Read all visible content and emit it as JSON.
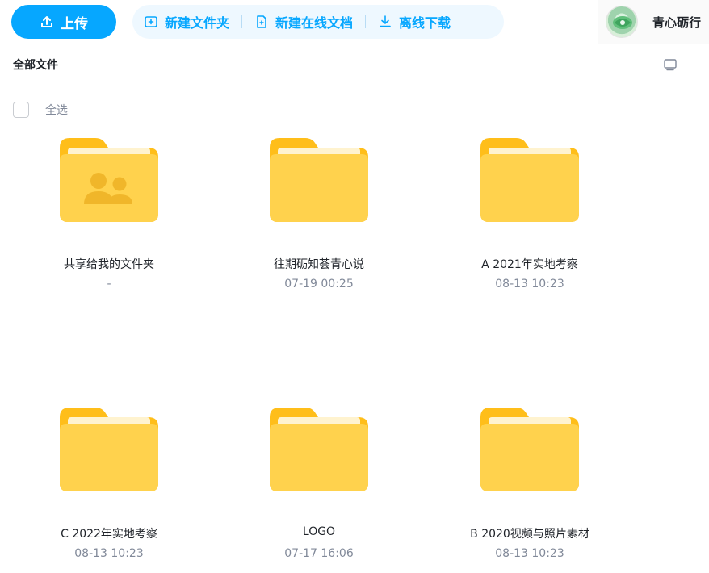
{
  "toolbar": {
    "upload_label": "上传",
    "new_folder_label": "新建文件夹",
    "new_online_doc_label": "新建在线文档",
    "offline_download_label": "离线下载"
  },
  "user": {
    "name": "青心砺行"
  },
  "breadcrumb": {
    "current": "全部文件"
  },
  "select_all_label": "全选",
  "colors": {
    "accent": "#06a7ff",
    "folder": "#ffd24d",
    "folder_tab": "#ffbe1a"
  },
  "files": [
    {
      "name": "共享给我的文件夹",
      "time": "-",
      "icon": "shared-folder-icon"
    },
    {
      "name": "往期砺知荟青心说",
      "time": "07-19 00:25",
      "icon": "folder-icon"
    },
    {
      "name": "A 2021年实地考察",
      "time": "08-13 10:23",
      "icon": "folder-icon"
    },
    {
      "name": "C 2022年实地考察",
      "time": "08-13 10:23",
      "icon": "folder-icon"
    },
    {
      "name": "LOGO",
      "time": "07-17 16:06",
      "icon": "folder-icon"
    },
    {
      "name": "B 2020视频与照片素材",
      "time": "08-13 10:23",
      "icon": "folder-icon"
    }
  ]
}
